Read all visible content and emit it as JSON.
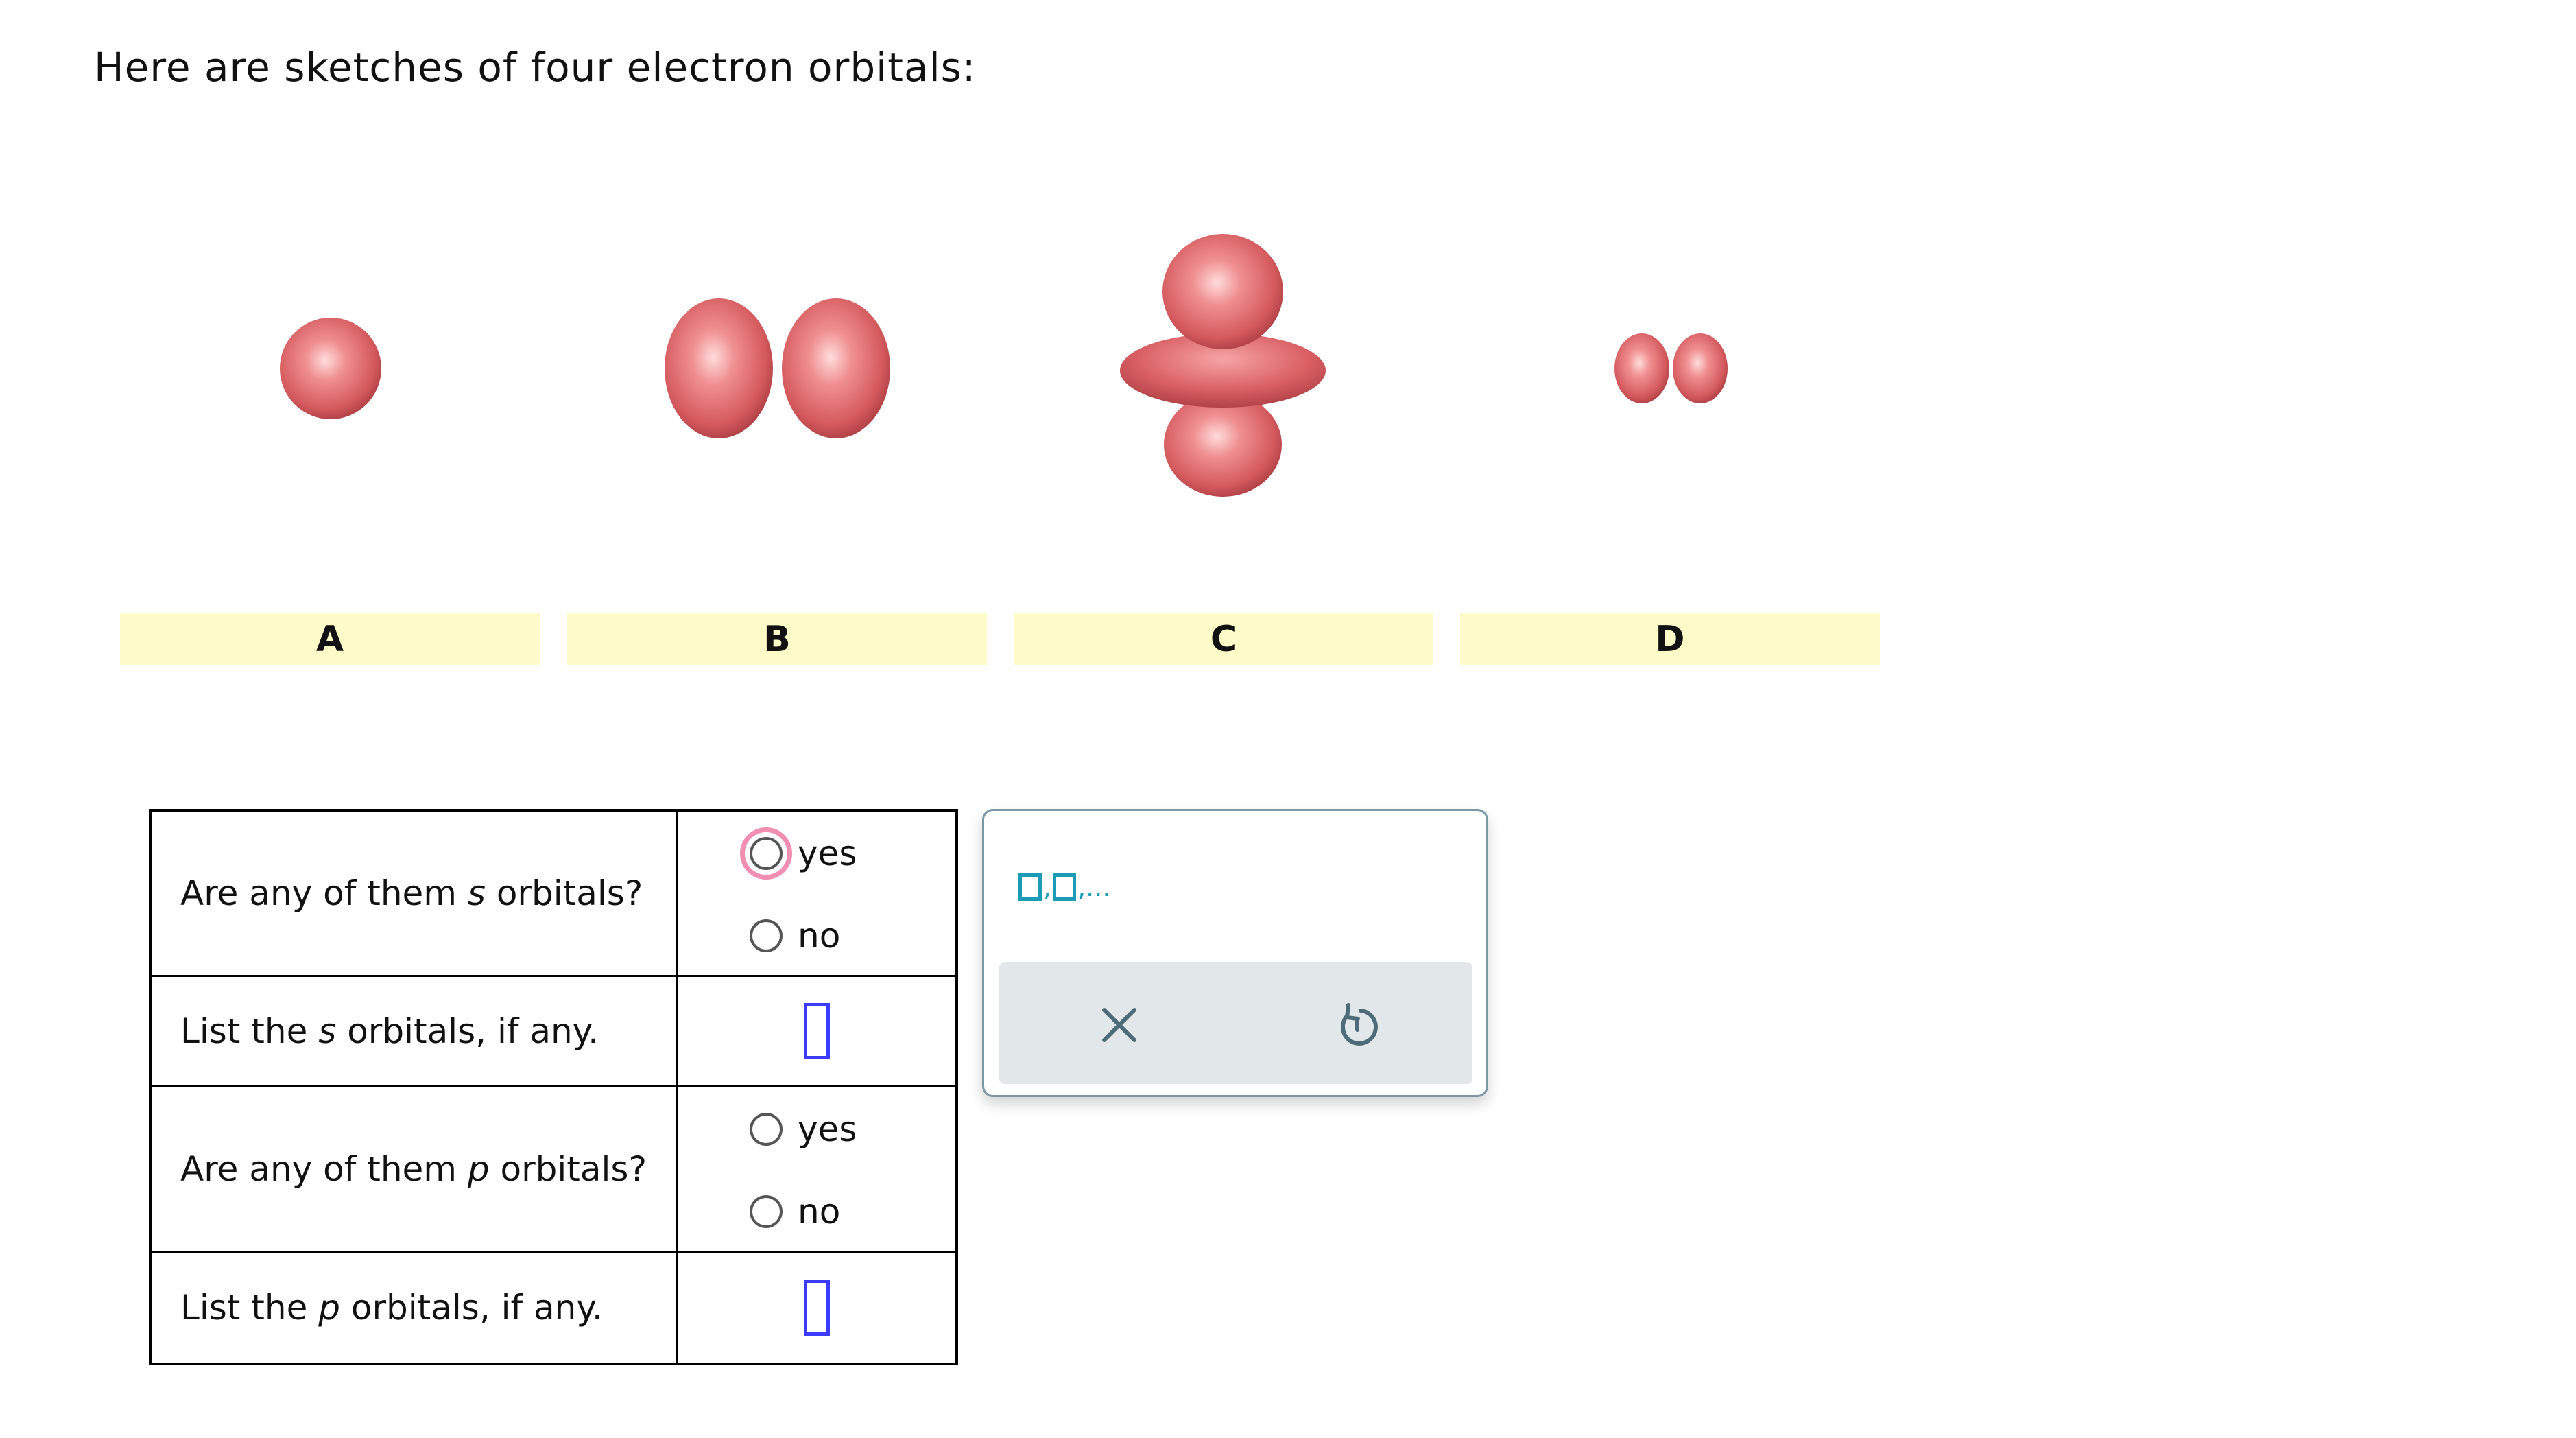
{
  "intro": "Here are sketches of four electron orbitals:",
  "orbital_labels": [
    "A",
    "B",
    "C",
    "D"
  ],
  "orbital_icons": [
    "s-orbital-icon",
    "p-orbital-icon",
    "dz2-orbital-icon",
    "small-p-orbital-icon"
  ],
  "orbital_color": "#e0666a",
  "label_bg": "#fefbc8",
  "table": {
    "q1": {
      "pre": "Are any of them ",
      "var": "s",
      "post": " orbitals?"
    },
    "q2": {
      "pre": "List the ",
      "var": "s",
      "post": " orbitals, if any."
    },
    "q3": {
      "pre": "Are any of them ",
      "var": "p",
      "post": " orbitals?"
    },
    "q4": {
      "pre": "List the ",
      "var": "p",
      "post": " orbitals, if any."
    },
    "yes": "yes",
    "no": "no"
  },
  "palette": {
    "template_sep1": ",",
    "template_sep2": ",...",
    "clear_icon": "x-icon",
    "undo_icon": "undo-icon"
  },
  "colors": {
    "answer_box": "#3c3cff",
    "palette_accent": "#1b9bb5",
    "focus_ring": "#f28fb1"
  }
}
